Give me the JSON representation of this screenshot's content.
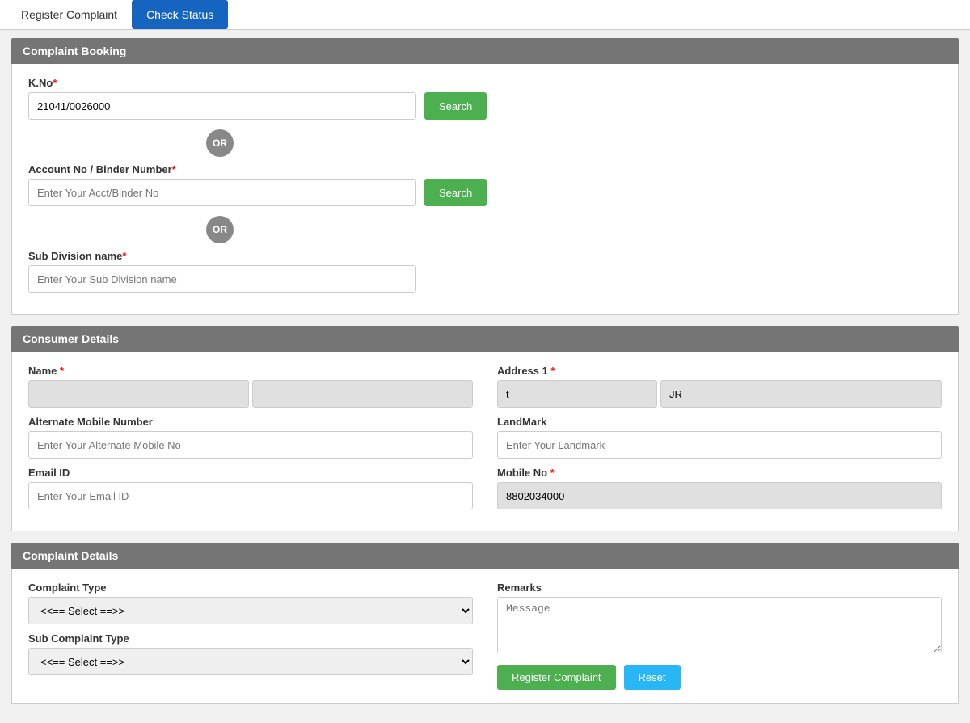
{
  "tabs": {
    "register": "Register Complaint",
    "checkStatus": "Check Status"
  },
  "sections": {
    "complaintBooking": {
      "header": "Complaint Booking",
      "kno": {
        "label": "K.No",
        "value": "21041/0026000",
        "placeholder": ""
      },
      "or1": "OR",
      "accountNo": {
        "label": "Account No / Binder Number",
        "placeholder": "Enter Your Acct/Binder No"
      },
      "or2": "OR",
      "subDivision": {
        "label": "Sub Division name",
        "placeholder": "Enter Your Sub Division name"
      },
      "searchLabel": "Search"
    },
    "consumerDetails": {
      "header": "Consumer Details",
      "name": {
        "label": "Name",
        "value1": "",
        "value2": ""
      },
      "address1": {
        "label": "Address 1",
        "value": "t",
        "value2": "JR"
      },
      "alternateMobile": {
        "label": "Alternate Mobile Number",
        "placeholder": "Enter Your Alternate Mobile No"
      },
      "landmark": {
        "label": "LandMark",
        "placeholder": "Enter Your Landmark"
      },
      "emailId": {
        "label": "Email ID",
        "placeholder": "Enter Your Email ID"
      },
      "mobileNo": {
        "label": "Mobile No",
        "value": "8802034000"
      }
    },
    "complaintDetails": {
      "header": "Complaint Details",
      "complaintType": {
        "label": "Complaint Type",
        "defaultOption": "<<==  Select  ==>>",
        "options": [
          "<<==  Select  ==>>"
        ]
      },
      "subComplaintType": {
        "label": "Sub Complaint Type",
        "defaultOption": "<<==  Select  ==>>",
        "options": [
          "<<==  Select  ==>>"
        ]
      },
      "remarks": {
        "label": "Remarks",
        "placeholder": "Message"
      },
      "registerBtn": "Register Complaint",
      "resetBtn": "Reset"
    }
  }
}
